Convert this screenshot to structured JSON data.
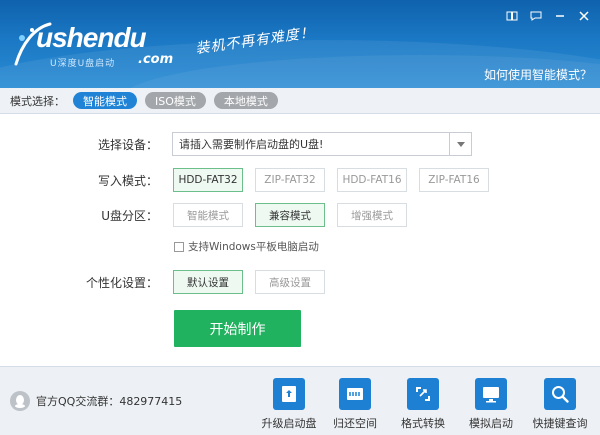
{
  "header": {
    "logo_text": "ushendu",
    "logo_sub": "U深度U盘启动",
    "logo_com": ".com",
    "slogan": "装机不再有难度！",
    "help_link": "如何使用智能模式？",
    "window_controls": [
      "book-icon",
      "chat-icon",
      "minimize-icon",
      "close-icon"
    ]
  },
  "mode_bar": {
    "label": "模式选择：",
    "modes": [
      {
        "label": "智能模式",
        "active": true
      },
      {
        "label": "ISO模式",
        "active": false
      },
      {
        "label": "本地模式",
        "active": false
      }
    ]
  },
  "form": {
    "device": {
      "label": "选择设备：",
      "value": "请插入需要制作启动盘的U盘!"
    },
    "write_mode": {
      "label": "写入模式：",
      "options": [
        "HDD-FAT32",
        "ZIP-FAT32",
        "HDD-FAT16",
        "ZIP-FAT16"
      ],
      "selected": "HDD-FAT32"
    },
    "partition": {
      "label": "U盘分区：",
      "options": [
        "智能模式",
        "兼容模式",
        "增强模式"
      ],
      "selected": "兼容模式"
    },
    "tablet_checkbox": {
      "label": "支持Windows平板电脑启动",
      "checked": false
    },
    "personalize": {
      "label": "个性化设置：",
      "options": [
        "默认设置",
        "高级设置"
      ],
      "selected": "默认设置"
    },
    "start_button": "开始制作"
  },
  "footer": {
    "qq_group": "官方QQ交流群：482977415",
    "tools": [
      {
        "label": "升级启动盘",
        "icon": "upgrade-disk-icon"
      },
      {
        "label": "归还空间",
        "icon": "restore-space-icon"
      },
      {
        "label": "格式转换",
        "icon": "format-convert-icon"
      },
      {
        "label": "模拟启动",
        "icon": "simulate-boot-icon"
      },
      {
        "label": "快捷键查询",
        "icon": "hotkey-search-icon"
      }
    ]
  },
  "colors": {
    "header": "#1b78c4",
    "accent": "#2183d6",
    "start": "#21b25f",
    "selected_border": "#6cbf8b"
  }
}
